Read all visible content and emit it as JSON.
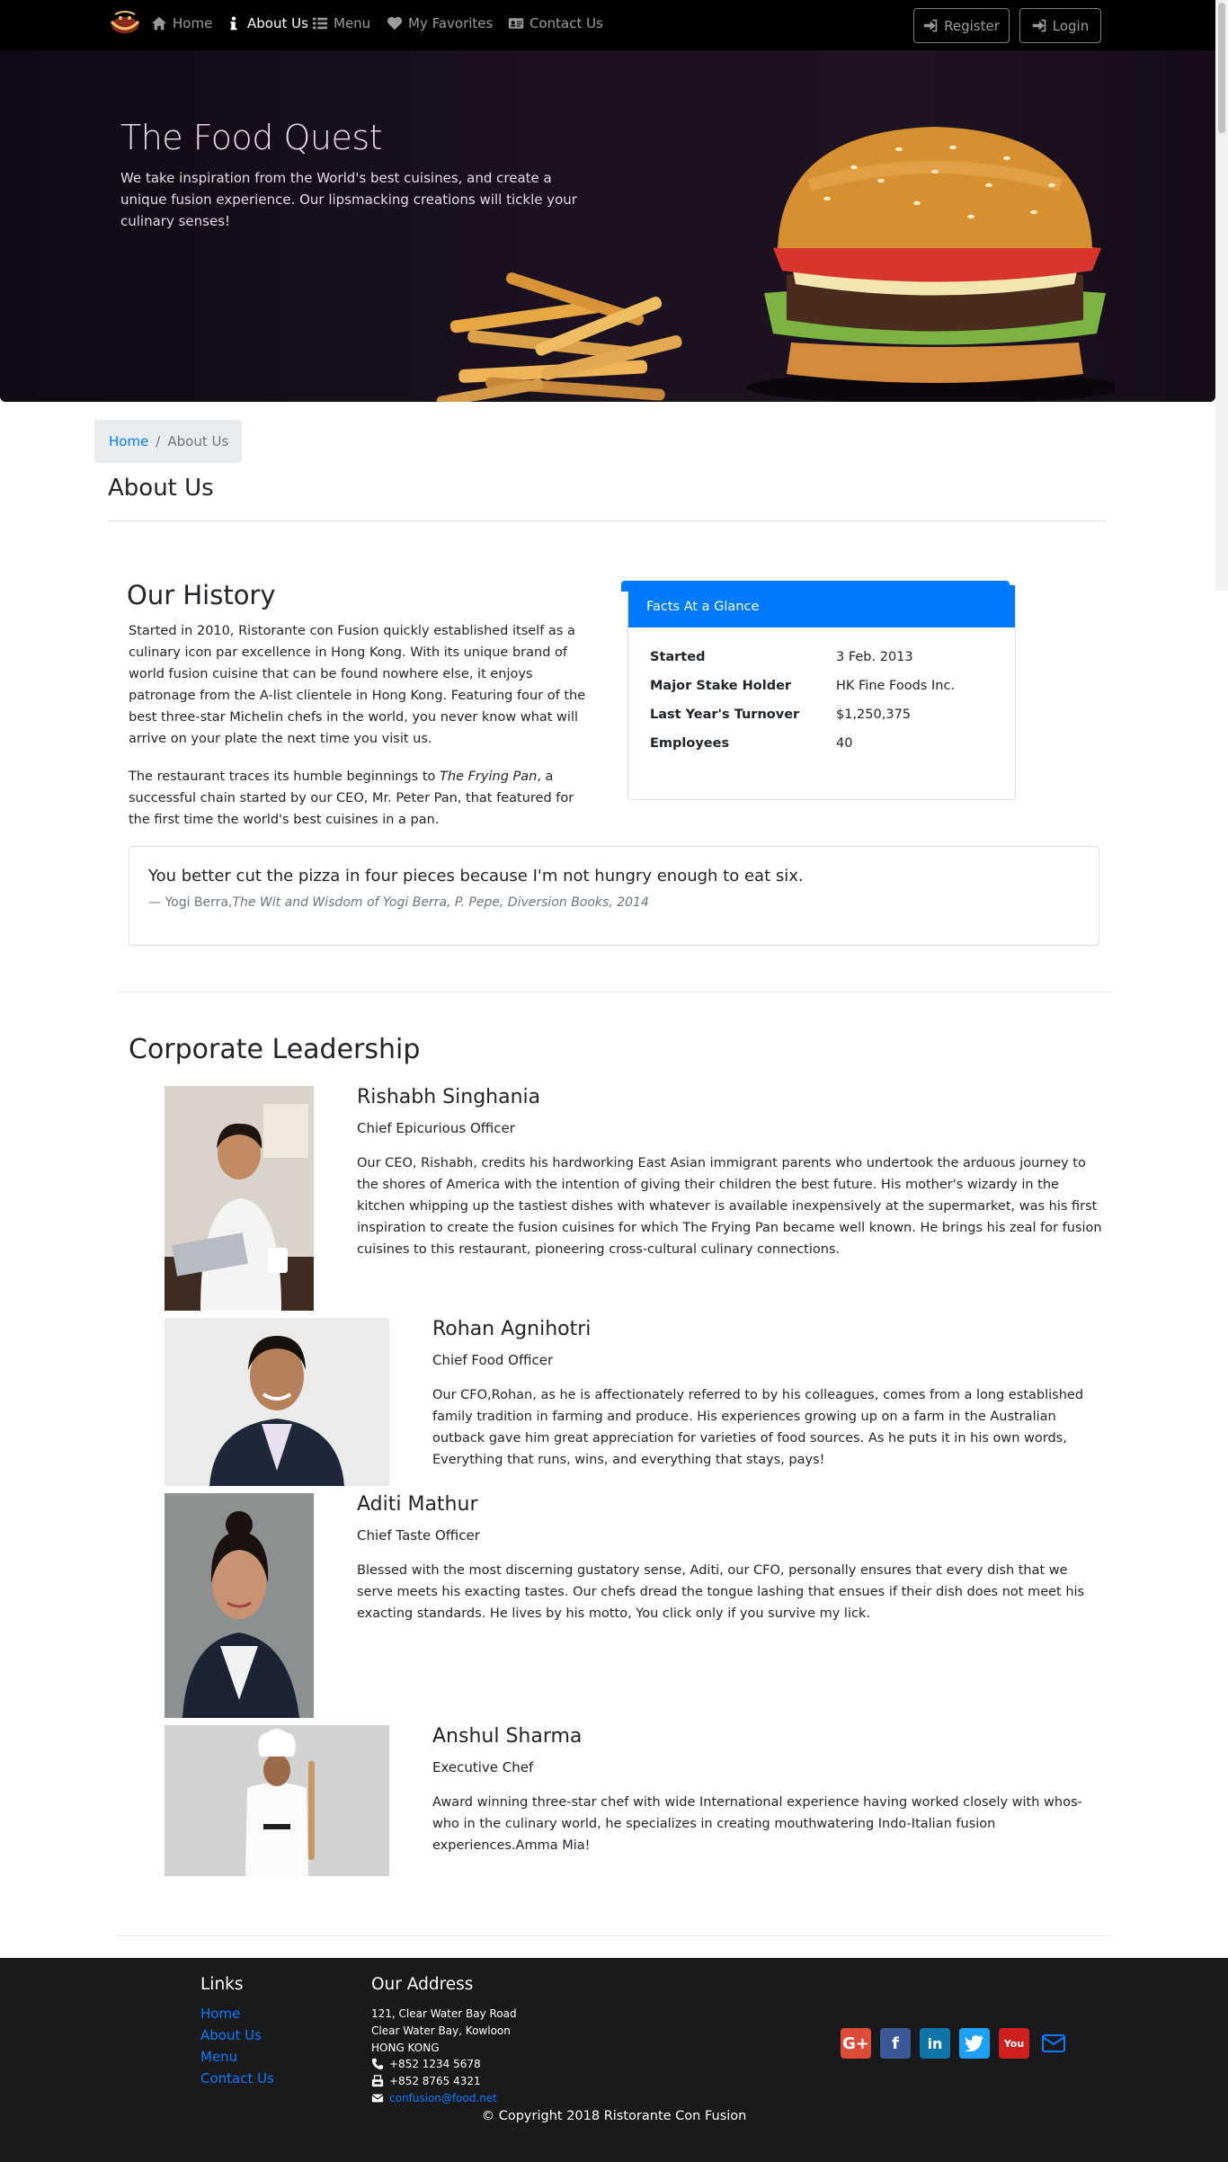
{
  "navbar": {
    "items": [
      {
        "label": "Home",
        "icon": "home-icon"
      },
      {
        "label": "About Us",
        "icon": "info-icon",
        "active": true
      },
      {
        "label": "Menu",
        "icon": "list-icon"
      },
      {
        "label": "My Favorites",
        "icon": "heart-icon"
      },
      {
        "label": "Contact Us",
        "icon": "address-card-icon"
      }
    ],
    "register_label": "Register",
    "login_label": "Login"
  },
  "jumbotron": {
    "title": "The Food Quest",
    "text": "We take inspiration from the World's best cuisines, and create a unique fusion experience. Our lipsmacking creations will tickle your culinary senses!"
  },
  "breadcrumb": {
    "home": "Home",
    "current": "About Us"
  },
  "page_title": "About Us",
  "history": {
    "title": "Our History",
    "p1": "Started in 2010, Ristorante con Fusion quickly established itself as a culinary icon par excellence in Hong Kong. With its unique brand of world fusion cuisine that can be found nowhere else, it enjoys patronage from the A-list clientele in Hong Kong. Featuring four of the best three-star Michelin chefs in the world, you never know what will arrive on your plate the next time you visit us.",
    "p2_before": "The restaurant traces its humble beginnings to ",
    "p2_italic": "The Frying Pan",
    "p2_after": ", a successful chain started by our CEO, Mr. Peter Pan, that featured for the first time the world's best cuisines in a pan."
  },
  "facts": {
    "header": "Facts At a Glance",
    "rows": [
      {
        "label": "Started",
        "value": "3 Feb. 2013"
      },
      {
        "label": "Major Stake Holder",
        "value": "HK Fine Foods Inc."
      },
      {
        "label": "Last Year's Turnover",
        "value": "$1,250,375"
      },
      {
        "label": "Employees",
        "value": "40"
      }
    ]
  },
  "quote": {
    "text": "You better cut the pizza in four pieces because I'm not hungry enough to eat six.",
    "prefix": "—  Yogi Berra,",
    "source": "The Wit and Wisdom of Yogi Berra, P. Pepe, Diversion Books, 2014"
  },
  "leadership": {
    "title": "Corporate Leadership",
    "leaders": [
      {
        "name": "Rishabh Singhania",
        "role": "Chief Epicurious Officer",
        "bio": "Our CEO, Rishabh, credits his hardworking East Asian immigrant parents who undertook the arduous journey to the shores of America with the intention of giving their children the best future. His mother's wizardy in the kitchen whipping up the tastiest dishes with whatever is available inexpensively at the supermarket, was his first inspiration to create the fusion cuisines for which The Frying Pan became well known. He brings his zeal for fusion cuisines to this restaurant, pioneering cross-cultural culinary connections."
      },
      {
        "name": "Rohan Agnihotri",
        "role": "Chief Food Officer",
        "bio": "Our CFO,Rohan, as he is affectionately referred to by his colleagues, comes from a long established family tradition in farming and produce. His experiences growing up on a farm in the Australian outback gave him great appreciation for varieties of food sources. As he puts it in his own words, Everything that runs, wins, and everything that stays, pays!"
      },
      {
        "name": "Aditi Mathur",
        "role": "Chief Taste Officer",
        "bio": "Blessed with the most discerning gustatory sense, Aditi, our CFO, personally ensures that every dish that we serve meets his exacting tastes. Our chefs dread the tongue lashing that ensues if their dish does not meet his exacting standards. He lives by his motto, You click only if you survive my lick."
      },
      {
        "name": "Anshul Sharma",
        "role": "Executive Chef",
        "bio": "Award winning three-star chef with wide International experience having worked closely with whos-who in the culinary world, he specializes in creating mouthwatering Indo-Italian fusion experiences.Amma Mia!"
      }
    ]
  },
  "footer": {
    "links_title": "Links",
    "links": [
      "Home",
      "About Us",
      "Menu",
      "Contact Us"
    ],
    "address_title": "Our Address",
    "address_lines": [
      "121, Clear Water Bay Road",
      "Clear Water Bay, Kowloon",
      "HONG KONG"
    ],
    "phone": "+852 1234 5678",
    "fax": "+852 8765 4321",
    "email": "confusion@food.net",
    "copyright": "© Copyright 2018 Ristorante Con Fusion",
    "social": [
      "google-plus-icon",
      "facebook-icon",
      "linkedin-icon",
      "twitter-icon",
      "youtube-icon",
      "mail-icon"
    ]
  },
  "colors": {
    "primary": "#007bff",
    "navbar": "#000000",
    "footer": "#1a1a1c"
  }
}
